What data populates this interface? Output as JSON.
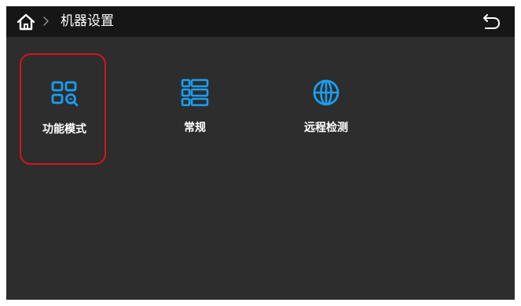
{
  "header": {
    "title": "机器设置",
    "home_icon": "home-icon",
    "separator_icon": "chevron-right-icon",
    "back_icon": "back-arrow-icon"
  },
  "menu": {
    "items": [
      {
        "label": "功能模式",
        "icon": "function-mode-icon",
        "selected": true
      },
      {
        "label": "常规",
        "icon": "list-grid-icon",
        "selected": false
      },
      {
        "label": "远程检测",
        "icon": "globe-icon",
        "selected": false
      }
    ]
  },
  "colors": {
    "accent": "#1a9ef0",
    "selection_border": "#d6141c",
    "background": "#2d2d2d",
    "topbar": "#161616",
    "text": "#ffffff"
  }
}
